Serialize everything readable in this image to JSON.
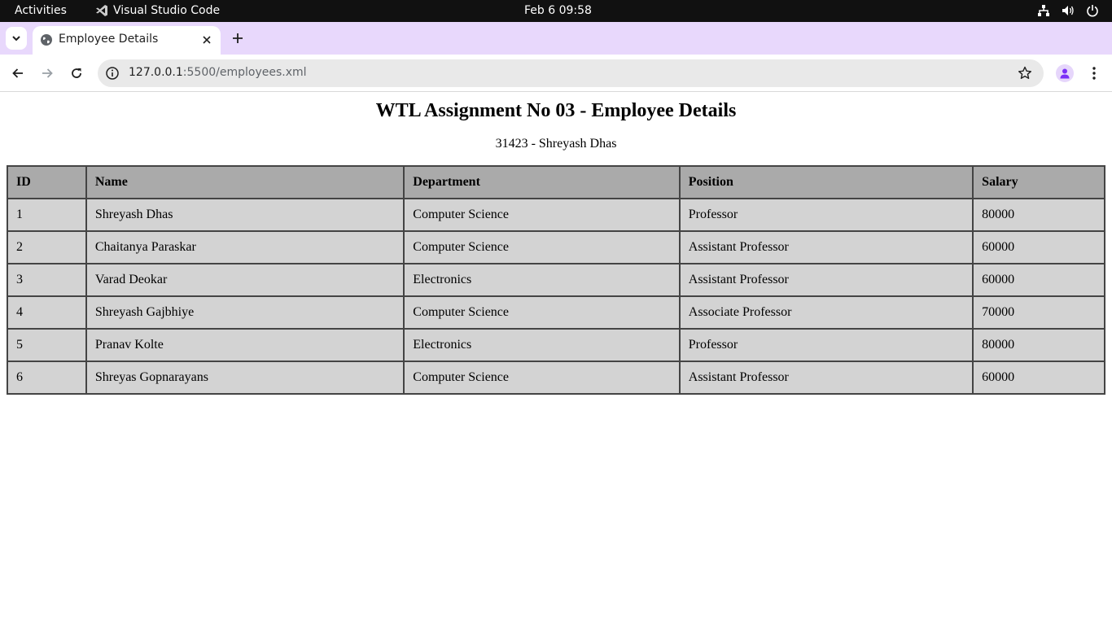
{
  "os_bar": {
    "activities": "Activities",
    "app_name": "Visual Studio Code",
    "clock": "Feb 6  09:58"
  },
  "browser": {
    "tab_title": "Employee Details",
    "url_host": "127.0.0.1",
    "url_rest": ":5500/employees.xml"
  },
  "page": {
    "title": "WTL Assignment No 03 - Employee Details",
    "subtitle": "31423 - Shreyash Dhas",
    "table": {
      "headers": [
        "ID",
        "Name",
        "Department",
        "Position",
        "Salary"
      ],
      "rows": [
        [
          "1",
          "Shreyash Dhas",
          "Computer Science",
          "Professor",
          "80000"
        ],
        [
          "2",
          "Chaitanya Paraskar",
          "Computer Science",
          "Assistant Professor",
          "60000"
        ],
        [
          "3",
          "Varad Deokar",
          "Electronics",
          "Assistant Professor",
          "60000"
        ],
        [
          "4",
          "Shreyash Gajbhiye",
          "Computer Science",
          "Associate Professor",
          "70000"
        ],
        [
          "5",
          "Pranav Kolte",
          "Electronics",
          "Professor",
          "80000"
        ],
        [
          "6",
          "Shreyas Gopnarayans",
          "Computer Science",
          "Assistant Professor",
          "60000"
        ]
      ]
    }
  },
  "icons": {
    "tab_search": "chevron-down-icon",
    "favicon": "globe-icon",
    "close": "close-icon",
    "new_tab": "plus-icon",
    "back": "arrow-left-icon",
    "forward": "arrow-right-icon",
    "reload": "reload-icon",
    "site_info": "info-icon",
    "bookmark": "star-icon",
    "profile": "person-icon",
    "menu": "more-vertical-icon",
    "network": "network-icon",
    "volume": "volume-icon",
    "power": "power-icon"
  },
  "colors": {
    "os_bar": "#111111",
    "tab_strip": "#e8d8fc",
    "table_header": "#aaaaaa",
    "table_cell": "#d3d3d3",
    "accent": "#7b2ff7"
  }
}
